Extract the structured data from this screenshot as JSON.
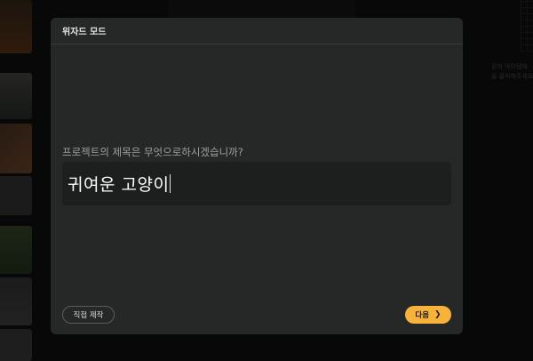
{
  "modal": {
    "title": "위자드 모드",
    "question": "프로젝트의 제목은 무엇으로하시겠습니까?",
    "answer_value": "귀여운 고양이",
    "direct_label": "직접 제작",
    "next_label": "다음",
    "next_icon": "chevron-right-icon",
    "accent_color": "#f7b23b"
  },
  "background": {
    "hint_line1": "원하 아이템에",
    "hint_line2": "을 클릭해주세요"
  }
}
